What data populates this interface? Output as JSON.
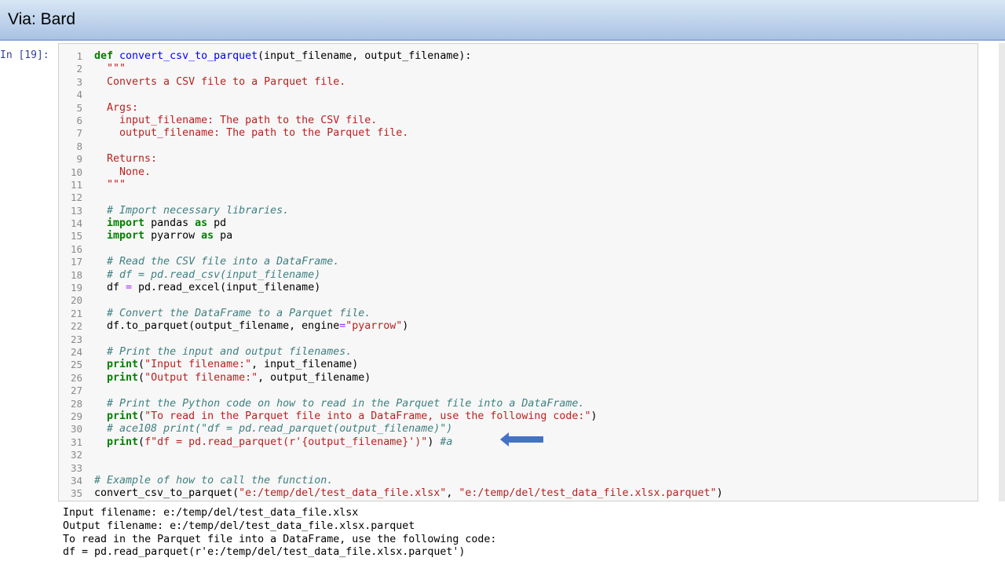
{
  "banner": {
    "title": "Via: Bard"
  },
  "cell": {
    "prompt": "In [19]:"
  },
  "code": [
    {
      "n": "1",
      "segs": [
        [
          "kw",
          "def "
        ],
        [
          "fn",
          "convert_csv_to_parquet"
        ],
        [
          "",
          "(input_filename, output_filename):"
        ]
      ]
    },
    {
      "n": "2",
      "segs": [
        [
          "st",
          "  \"\"\""
        ]
      ]
    },
    {
      "n": "3",
      "segs": [
        [
          "st",
          "  Converts a CSV file to a Parquet file."
        ]
      ]
    },
    {
      "n": "4",
      "segs": []
    },
    {
      "n": "5",
      "segs": [
        [
          "st",
          "  Args:"
        ]
      ]
    },
    {
      "n": "6",
      "segs": [
        [
          "st",
          "    input_filename: The path to the CSV file."
        ]
      ]
    },
    {
      "n": "7",
      "segs": [
        [
          "st",
          "    output_filename: The path to the Parquet file."
        ]
      ]
    },
    {
      "n": "8",
      "segs": []
    },
    {
      "n": "9",
      "segs": [
        [
          "st",
          "  Returns:"
        ]
      ]
    },
    {
      "n": "10",
      "segs": [
        [
          "st",
          "    None."
        ]
      ]
    },
    {
      "n": "11",
      "segs": [
        [
          "st",
          "  \"\"\""
        ]
      ]
    },
    {
      "n": "12",
      "segs": []
    },
    {
      "n": "13",
      "segs": [
        [
          "cm",
          "  # Import necessary libraries."
        ]
      ]
    },
    {
      "n": "14",
      "segs": [
        [
          "kw",
          "  import "
        ],
        [
          "",
          "pandas "
        ],
        [
          "kw",
          "as "
        ],
        [
          "",
          "pd"
        ]
      ]
    },
    {
      "n": "15",
      "segs": [
        [
          "kw",
          "  import "
        ],
        [
          "",
          "pyarrow "
        ],
        [
          "kw",
          "as "
        ],
        [
          "",
          "pa"
        ]
      ]
    },
    {
      "n": "16",
      "segs": []
    },
    {
      "n": "17",
      "segs": [
        [
          "cm",
          "  # Read the CSV file into a DataFrame."
        ]
      ]
    },
    {
      "n": "18",
      "segs": [
        [
          "cm",
          "  # df = pd.read_csv(input_filename)"
        ]
      ]
    },
    {
      "n": "19",
      "segs": [
        [
          "",
          "  df "
        ],
        [
          "op",
          "= "
        ],
        [
          "",
          "pd.read_excel(input_filename)"
        ]
      ]
    },
    {
      "n": "20",
      "segs": []
    },
    {
      "n": "21",
      "segs": [
        [
          "cm",
          "  # Convert the DataFrame to a Parquet file."
        ]
      ]
    },
    {
      "n": "22",
      "segs": [
        [
          "",
          "  df.to_parquet(output_filename, engine"
        ],
        [
          "op",
          "="
        ],
        [
          "st",
          "\"pyarrow\""
        ],
        [
          "",
          ")"
        ]
      ]
    },
    {
      "n": "23",
      "segs": []
    },
    {
      "n": "24",
      "segs": [
        [
          "cm",
          "  # Print the input and output filenames."
        ]
      ]
    },
    {
      "n": "25",
      "segs": [
        [
          "kw",
          "  print"
        ],
        [
          "",
          "("
        ],
        [
          "st",
          "\"Input filename:\""
        ],
        [
          "",
          ", input_filename)"
        ]
      ]
    },
    {
      "n": "26",
      "segs": [
        [
          "kw",
          "  print"
        ],
        [
          "",
          "("
        ],
        [
          "st",
          "\"Output filename:\""
        ],
        [
          "",
          ", output_filename)"
        ]
      ]
    },
    {
      "n": "27",
      "segs": []
    },
    {
      "n": "28",
      "segs": [
        [
          "cm",
          "  # Print the Python code on how to read in the Parquet file into a DataFrame."
        ]
      ]
    },
    {
      "n": "29",
      "segs": [
        [
          "kw",
          "  print"
        ],
        [
          "",
          "("
        ],
        [
          "st",
          "\"To read in the Parquet file into a DataFrame, use the following code:\""
        ],
        [
          "",
          ")"
        ]
      ]
    },
    {
      "n": "30",
      "segs": [
        [
          "cm",
          "  # ace108 print(\"df = pd.read_parquet(output_filename)\")"
        ]
      ]
    },
    {
      "n": "31",
      "segs": [
        [
          "kw",
          "  print"
        ],
        [
          "",
          "("
        ],
        [
          "st",
          "f\"df = pd.read_parquet(r'{output_filename}')\""
        ],
        [
          "",
          ") "
        ],
        [
          "cm",
          "#a"
        ]
      ]
    },
    {
      "n": "32",
      "segs": []
    },
    {
      "n": "33",
      "segs": []
    },
    {
      "n": "34",
      "segs": [
        [
          "cm",
          "# Example of how to call the function."
        ]
      ]
    },
    {
      "n": "35",
      "segs": [
        [
          "",
          "convert_csv_to_parquet("
        ],
        [
          "st",
          "\"e:/temp/del/test_data_file.xlsx\""
        ],
        [
          "",
          ", "
        ],
        [
          "st",
          "\"e:/temp/del/test_data_file.xlsx.parquet\""
        ],
        [
          "",
          ")"
        ]
      ]
    }
  ],
  "output": [
    "Input filename: e:/temp/del/test_data_file.xlsx",
    "Output filename: e:/temp/del/test_data_file.xlsx.parquet",
    "To read in the Parquet file into a DataFrame, use the following code:",
    "df = pd.read_parquet(r'e:/temp/del/test_data_file.xlsx.parquet')"
  ],
  "colors": {
    "arrow": "#4472c4",
    "banner_top": "#d9e6f5",
    "banner_bottom": "#a9c3e3"
  },
  "icons": {
    "annotation": "left-arrow-icon"
  }
}
